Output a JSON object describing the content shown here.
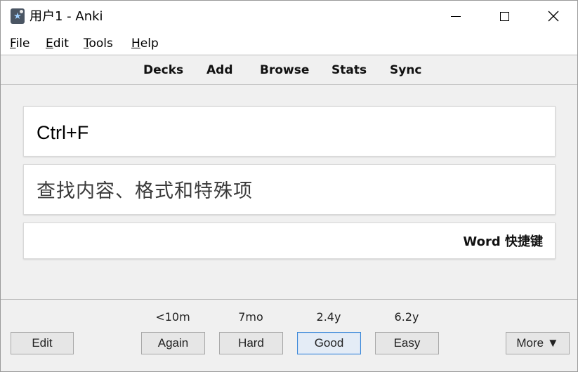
{
  "window": {
    "title": "用户1 - Anki",
    "icon": "anki-icon",
    "controls": {
      "minimize": "minimize-icon",
      "maximize": "maximize-icon",
      "close": "close-icon"
    }
  },
  "menu": {
    "items": [
      {
        "label_underlined": "F",
        "label_rest": "ile"
      },
      {
        "label_underlined": "E",
        "label_rest": "dit"
      },
      {
        "label_underlined": "T",
        "label_rest": "ools"
      },
      {
        "label_underlined": "H",
        "label_rest": "elp"
      }
    ]
  },
  "toolbar": {
    "decks": "Decks",
    "add": "Add",
    "browse": "Browse",
    "stats": "Stats",
    "sync": "Sync"
  },
  "card": {
    "front": "Ctrl+F",
    "back": "查找内容、格式和特殊项",
    "tag": "Word 快捷键"
  },
  "review": {
    "intervals": {
      "again": "<10m",
      "hard": "7mo",
      "good": "2.4y",
      "easy": "6.2y"
    },
    "buttons": {
      "edit": "Edit",
      "again": "Again",
      "hard": "Hard",
      "good": "Good",
      "easy": "Easy",
      "more": "More ▼"
    },
    "focused_button": "good",
    "focus_color": "#3c88d8"
  }
}
